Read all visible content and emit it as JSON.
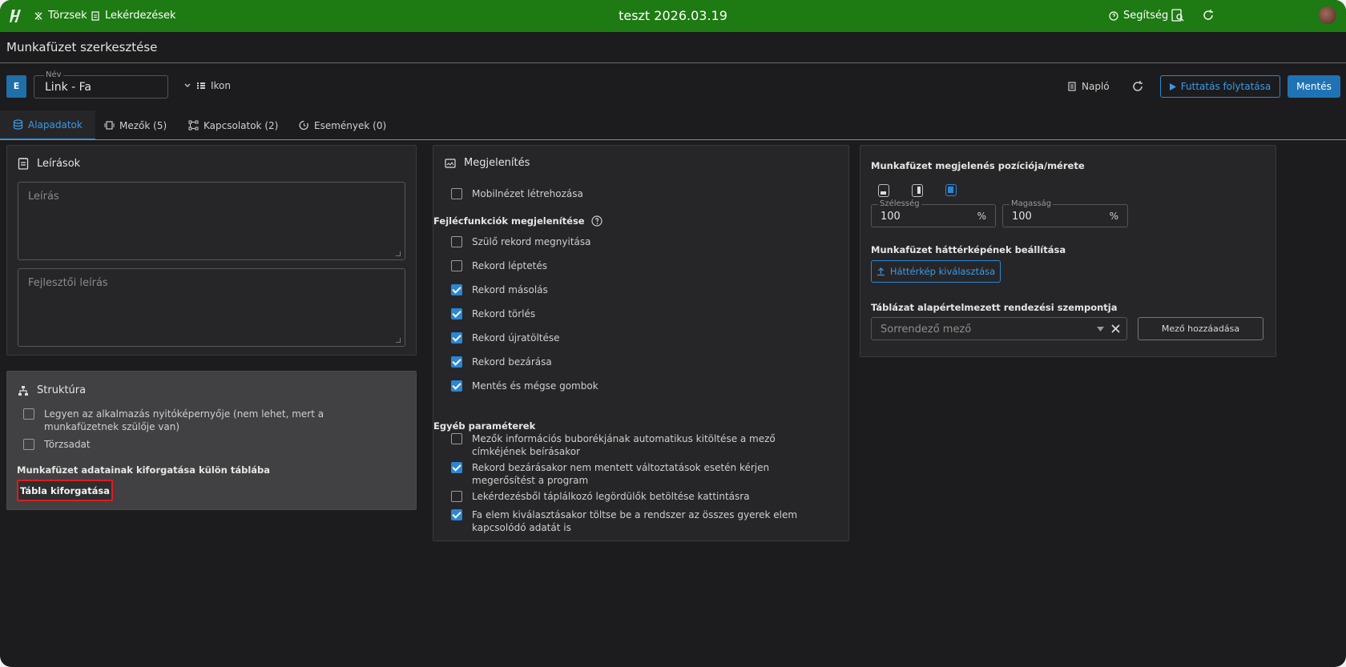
{
  "topbar": {
    "nav": [
      {
        "label": "Törzsek",
        "icon": "tools-icon"
      },
      {
        "label": "Lekérdezések",
        "icon": "document-icon"
      }
    ],
    "title": "teszt 2026.03.19",
    "help_label": "Segítség"
  },
  "header": {
    "page_title": "Munkafüzet szerkesztése",
    "badge": "E",
    "name_label": "Név",
    "name_value": "Link - Fa",
    "icon_label": "Ikon",
    "log_label": "Napló",
    "run_label": "Futtatás folytatása",
    "save_label": "Mentés"
  },
  "tabs": [
    {
      "label": "Alapadatok",
      "active": true
    },
    {
      "label": "Mezők (5)",
      "active": false
    },
    {
      "label": "Kapcsolatok (2)",
      "active": false
    },
    {
      "label": "Események (0)",
      "active": false
    }
  ],
  "descriptions": {
    "title": "Leírások",
    "description_placeholder": "Leírás",
    "dev_description_placeholder": "Fejlesztői leírás"
  },
  "structure": {
    "title": "Struktúra",
    "checkboxes": [
      {
        "label": "Legyen az alkalmazás nyitóképernyője (nem lehet, mert a munkafüzetnek szülője van)",
        "checked": false
      },
      {
        "label": "Törzsadat",
        "checked": false
      }
    ],
    "pivot_heading": "Munkafüzet adatainak kiforgatása külön táblába",
    "pivot_button": "Tábla kiforgatása"
  },
  "display": {
    "title": "Megjelenítés",
    "mobile": {
      "label": "Mobilnézet létrehozása",
      "checked": false
    },
    "header_functions_label": "Fejlécfunkciók megjelenítése",
    "header_functions": [
      {
        "label": "Szülő rekord megnyitása",
        "checked": false
      },
      {
        "label": "Rekord léptetés",
        "checked": false
      },
      {
        "label": "Rekord másolás",
        "checked": true
      },
      {
        "label": "Rekord törlés",
        "checked": true
      },
      {
        "label": "Rekord újratöltése",
        "checked": true
      },
      {
        "label": "Rekord bezárása",
        "checked": true
      },
      {
        "label": "Mentés és mégse gombok",
        "checked": true
      }
    ],
    "other_params_label": "Egyéb paraméterek",
    "other_params": [
      {
        "label": "Mezők információs buborékjának automatikus kitöltése a mező címkéjének beírásakor",
        "checked": false
      },
      {
        "label": "Rekord bezárásakor nem mentett változtatások esetén kérjen megerősítést a program",
        "checked": true
      },
      {
        "label": "Lekérdezésből táplálkozó legördülők betöltése kattintásra",
        "checked": false
      },
      {
        "label": "Fa elem kiválasztásakor töltse be a rendszer az összes gyerek elem kapcsolódó adatát is",
        "checked": true
      }
    ]
  },
  "position": {
    "title": "Munkafüzet megjelenés pozíciója/mérete",
    "width_label": "Szélesség",
    "width_value": "100",
    "width_unit": "%",
    "height_label": "Magasság",
    "height_value": "100",
    "height_unit": "%",
    "background_label": "Munkafüzet háttérképének beállítása",
    "background_button": "Háttérkép kiválasztása",
    "sort_label": "Táblázat alapértelmezett rendezési szempontja",
    "sort_placeholder": "Sorrendező mező",
    "add_field_button": "Mező hozzáadása"
  },
  "colors": {
    "topbar": "#1e7a12",
    "accent": "#2b87d1",
    "highlight": "#e01b1b"
  }
}
